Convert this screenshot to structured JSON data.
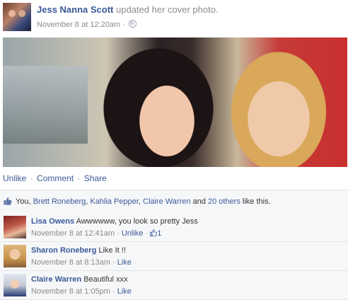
{
  "post": {
    "author": "Jess Nanna Scott",
    "action": "updated her cover photo.",
    "timestamp": "November 8 at 12:20am",
    "separator": "·",
    "privacy_icon": "globe-icon"
  },
  "actions": {
    "unlike": "Unlike",
    "comment": "Comment",
    "share": "Share",
    "sep": "·"
  },
  "likes": {
    "you": "You,",
    "people": [
      "Brett Roneberg",
      "Kahlia Pepper",
      "Claire Warren"
    ],
    "comma": ",",
    "and": "and",
    "others": "20 others",
    "tail": "like this."
  },
  "comments": [
    {
      "name": "Lisa Owens",
      "text": "Awwwwww, you look so pretty Jess",
      "time": "November 8 at 12:41am",
      "sep": "·",
      "action": "Unlike",
      "likes_count": "1"
    },
    {
      "name": "Sharon Roneberg",
      "text": "Like It !!",
      "time": "November 8 at 8:13am",
      "sep": "·",
      "action": "Like"
    },
    {
      "name": "Claire Warren",
      "text": "Beautiful xxx",
      "time": "November 8 at 1:05pm",
      "sep": "·",
      "action": "Like"
    }
  ],
  "colors": {
    "link": "#3b5998",
    "meta": "#8b8b8b",
    "panel": "#f6f7f9"
  }
}
